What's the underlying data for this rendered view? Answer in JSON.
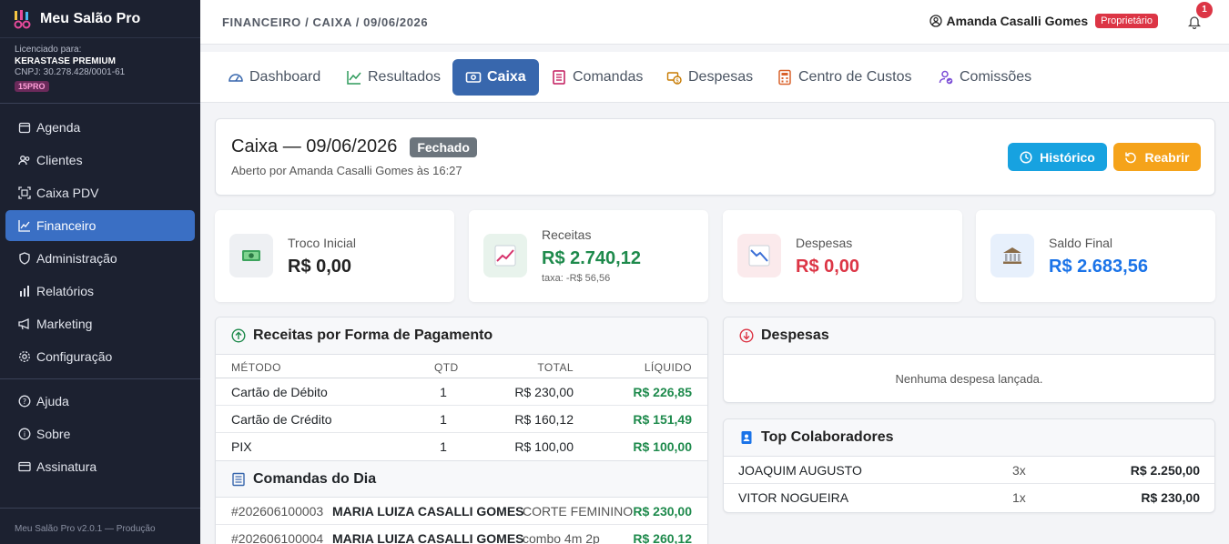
{
  "app": {
    "name": "Meu Salão Pro"
  },
  "license": {
    "label": "Licenciado para:",
    "company": "KERASTASE PREMIUM",
    "cnpj": "CNPJ: 30.278.428/0001-61",
    "badge": "15PRO"
  },
  "sidebar": {
    "items": [
      {
        "label": "Agenda",
        "icon": "calendar-icon"
      },
      {
        "label": "Clientes",
        "icon": "users-icon"
      },
      {
        "label": "Caixa PDV",
        "icon": "scan-icon"
      },
      {
        "label": "Financeiro",
        "icon": "chart-line-icon"
      },
      {
        "label": "Administração",
        "icon": "shield-icon"
      },
      {
        "label": "Relatórios",
        "icon": "bar-chart-icon"
      },
      {
        "label": "Marketing",
        "icon": "megaphone-icon"
      },
      {
        "label": "Configuração",
        "icon": "gear-icon"
      }
    ],
    "bottom_items": [
      {
        "label": "Ajuda",
        "icon": "question-icon"
      },
      {
        "label": "Sobre",
        "icon": "info-icon"
      },
      {
        "label": "Assinatura",
        "icon": "card-icon"
      }
    ],
    "version": "Meu Salão Pro v2.0.1 — Produção"
  },
  "header": {
    "breadcrumb": "FINANCEIRO / CAIXA / 09/06/2026",
    "user": "Amanda Casalli Gomes",
    "role": "Proprietário",
    "notifications": "1"
  },
  "tabs": [
    {
      "label": "Dashboard"
    },
    {
      "label": "Resultados"
    },
    {
      "label": "Caixa"
    },
    {
      "label": "Comandas"
    },
    {
      "label": "Despesas"
    },
    {
      "label": "Centro de Custos"
    },
    {
      "label": "Comissões"
    }
  ],
  "caixa": {
    "title": "Caixa — 09/06/2026",
    "status": "Fechado",
    "subtitle": "Aberto por Amanda Casalli Gomes às 16:27",
    "btn_historico": "Histórico",
    "btn_reabrir": "Reabrir"
  },
  "stats": {
    "troco": {
      "label": "Troco Inicial",
      "value": "R$ 0,00"
    },
    "receitas": {
      "label": "Receitas",
      "value": "R$ 2.740,12",
      "note": "taxa: -R$ 56,56"
    },
    "despesas": {
      "label": "Despesas",
      "value": "R$ 0,00"
    },
    "saldo": {
      "label": "Saldo Final",
      "value": "R$ 2.683,56"
    }
  },
  "colors": {
    "green": "#1e8a4c",
    "red": "#dc3545",
    "blue": "#1a73e8",
    "accent": "#3867ad"
  },
  "receitas_panel": {
    "title": "Receitas por Forma de Pagamento",
    "headers": {
      "metodo": "MÉTODO",
      "qtd": "QTD",
      "total": "TOTAL",
      "liquido": "LÍQUIDO"
    },
    "rows": [
      {
        "metodo": "Cartão de Débito",
        "qtd": "1",
        "total": "R$ 230,00",
        "liquido": "R$ 226,85"
      },
      {
        "metodo": "Cartão de Crédito",
        "qtd": "1",
        "total": "R$ 160,12",
        "liquido": "R$ 151,49"
      },
      {
        "metodo": "PIX",
        "qtd": "1",
        "total": "R$ 100,00",
        "liquido": "R$ 100,00"
      }
    ]
  },
  "comandas": {
    "title": "Comandas do Dia",
    "rows": [
      {
        "id": "#202606100003",
        "cliente": "MARIA LUIZA CASALLI GOMES",
        "servico": "CORTE FEMININO",
        "valor": "R$ 230,00"
      },
      {
        "id": "#202606100004",
        "cliente": "MARIA LUIZA CASALLI GOMES",
        "servico": "combo 4m 2p",
        "valor": "R$ 260,12"
      }
    ]
  },
  "despesas_panel": {
    "title": "Despesas",
    "empty": "Nenhuma despesa lançada."
  },
  "top": {
    "title": "Top Colaboradores",
    "rows": [
      {
        "nome": "JOAQUIM AUGUSTO",
        "qtd": "3x",
        "valor": "R$ 2.250,00"
      },
      {
        "nome": "VITOR NOGUEIRA",
        "qtd": "1x",
        "valor": "R$ 230,00"
      }
    ]
  }
}
